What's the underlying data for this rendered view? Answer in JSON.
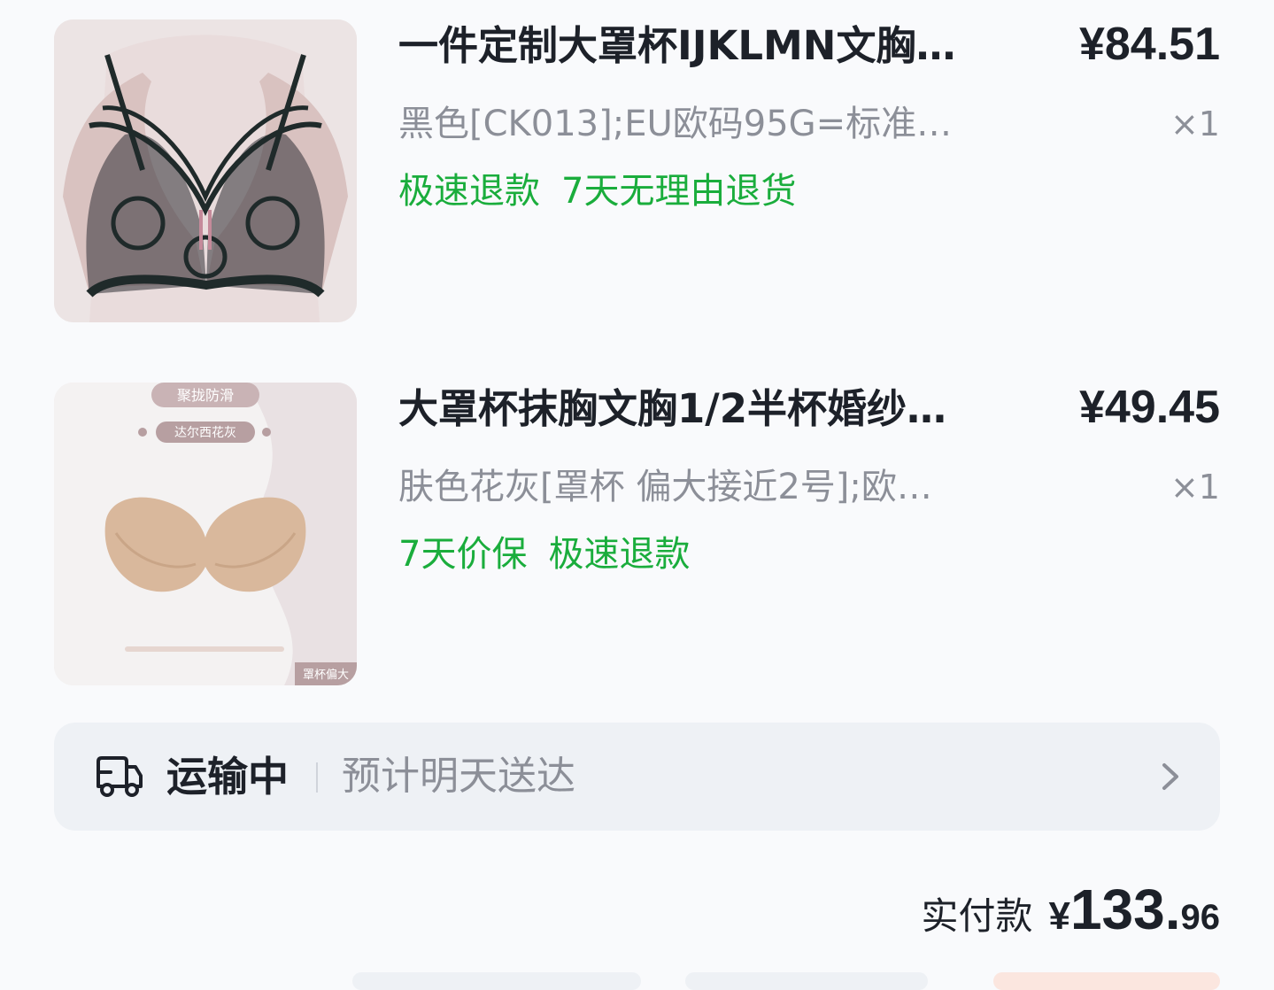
{
  "items": [
    {
      "title": "一件定制大罩杯IJKLMN文胸…",
      "price": "¥84.51",
      "spec": "黑色[CK013];EU欧码95G=标准…",
      "qty": "×1",
      "tags": [
        "极速退款",
        "7天无理由退货"
      ],
      "image_icon": "black-lace-bra-image"
    },
    {
      "title": "大罩杯抹胸文胸1/2半杯婚纱…",
      "price": "¥49.45",
      "spec": "肤色花灰[罩杯 偏大接近2号];欧…",
      "qty": "×1",
      "tags": [
        "7天价保",
        "极速退款"
      ],
      "image_icon": "nude-strapless-bra-image",
      "image_texts": {
        "badge_top": "聚拢防滑",
        "badge_color": "达尔西花灰",
        "corner": "罩杯偏大"
      }
    }
  ],
  "shipping": {
    "status": "运输中",
    "eta": "预计明天送达",
    "icon": "truck-icon",
    "chevron_icon": "chevron-right-icon"
  },
  "total": {
    "label": "实付款",
    "currency": "¥",
    "integer": "133.",
    "decimal": "96"
  },
  "colors": {
    "accent_green": "#1aad3c",
    "muted_text": "#8c8f98",
    "primary_text": "#1d2129",
    "card_bg": "#eef1f5"
  }
}
